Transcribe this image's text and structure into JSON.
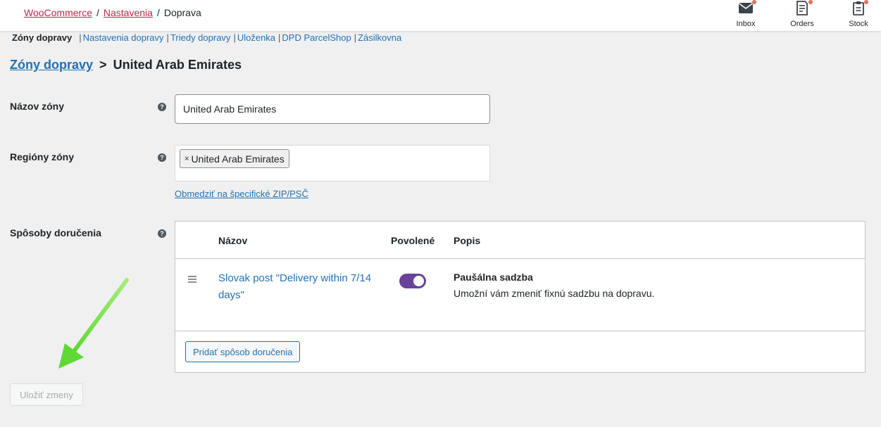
{
  "breadcrumb": {
    "woocommerce": "WooCommerce",
    "settings": "Nastavenia",
    "current": "Doprava",
    "separator": "/"
  },
  "activity_panel": [
    {
      "label": "Inbox",
      "icon": "inbox-icon",
      "has_notification": true
    },
    {
      "label": "Orders",
      "icon": "orders-icon",
      "has_notification": true
    },
    {
      "label": "Stock",
      "icon": "stock-icon",
      "has_notification": true
    }
  ],
  "subnav": {
    "current": "Zóny dopravy",
    "links": [
      "Nastavenia dopravy",
      "Triedy dopravy",
      "Uloženka",
      "DPD ParcelShop",
      "Zásilkovna"
    ],
    "separator": "|"
  },
  "title": {
    "parent_link": "Zóny dopravy",
    "separator": ">",
    "zone": "United Arab Emirates"
  },
  "form": {
    "zone_name_label": "Názov zóny",
    "zone_name_value": "United Arab Emirates",
    "regions_label": "Regióny zóny",
    "region_tags": [
      "United Arab Emirates"
    ],
    "region_remove_glyph": "×",
    "limit_link": "Obmedziť na špecifické ZIP/PSČ",
    "methods_label": "Spôsoby doručenia",
    "help_glyph": "?"
  },
  "methods_table": {
    "headers": {
      "name": "Názov",
      "enabled": "Povolené",
      "description": "Popis"
    },
    "rows": [
      {
        "name": "Slovak post \"Delivery within 7/14 days\"",
        "enabled": true,
        "desc_title": "Paušálna sadzba",
        "desc_text": "Umožní vám zmeniť fixnú sadzbu na dopravu."
      }
    ],
    "add_button": "Pridať spôsob doručenia"
  },
  "save_button": "Uložiť zmeny",
  "colors": {
    "link": "#2271b1",
    "breadcrumb_link": "#c8244b",
    "toggle_on": "#674399",
    "notification_dot": "#e26f56",
    "annotation_arrow": "#6fdc3c"
  }
}
